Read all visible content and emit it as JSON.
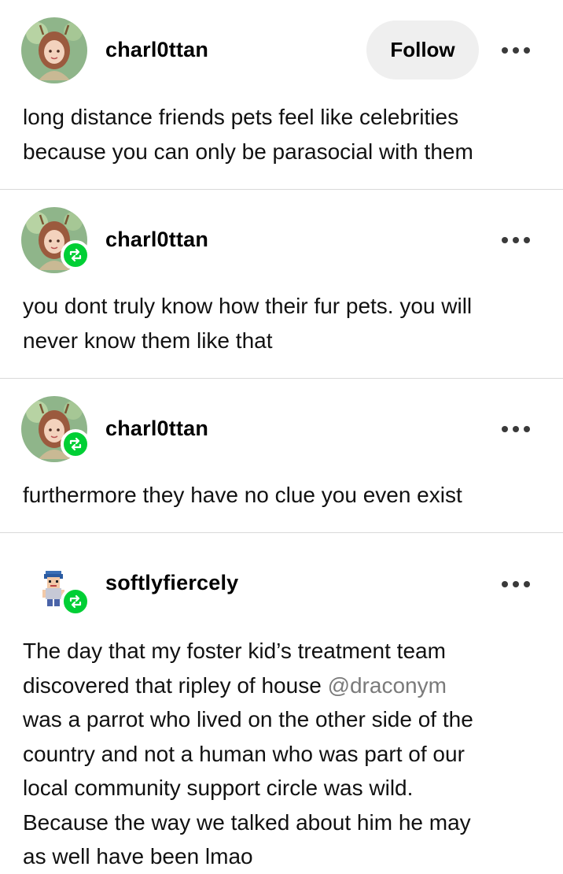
{
  "posts": [
    {
      "username": "charl0ttan",
      "follow_label": "Follow",
      "text_lines": [
        "long distance friends pets feel like celebrities",
        "because you can only be parasocial with them"
      ]
    },
    {
      "username": "charl0ttan",
      "text_lines": [
        "you dont truly know how their fur pets. you will",
        "never know them like that"
      ]
    },
    {
      "username": "charl0ttan",
      "text_lines": [
        "furthermore they have no clue you even exist"
      ]
    },
    {
      "username": "softlyfiercely",
      "text_lines": [
        "The day that my foster kid’s treatment team",
        "discovered that ripley of house ",
        "was a parrot who lived on the other side of the",
        "country and not a human who was part of our",
        "local community support circle was wild.",
        "Because the way we talked about him he may",
        "as well have been lmao"
      ],
      "mention": "@draconym"
    }
  ],
  "colors": {
    "reblog_badge": "#00cf35",
    "mention": "#7a7a7a",
    "follow_bg": "#efefef"
  },
  "icons": {
    "more": "ellipsis-icon",
    "reblog": "reblog-icon"
  }
}
